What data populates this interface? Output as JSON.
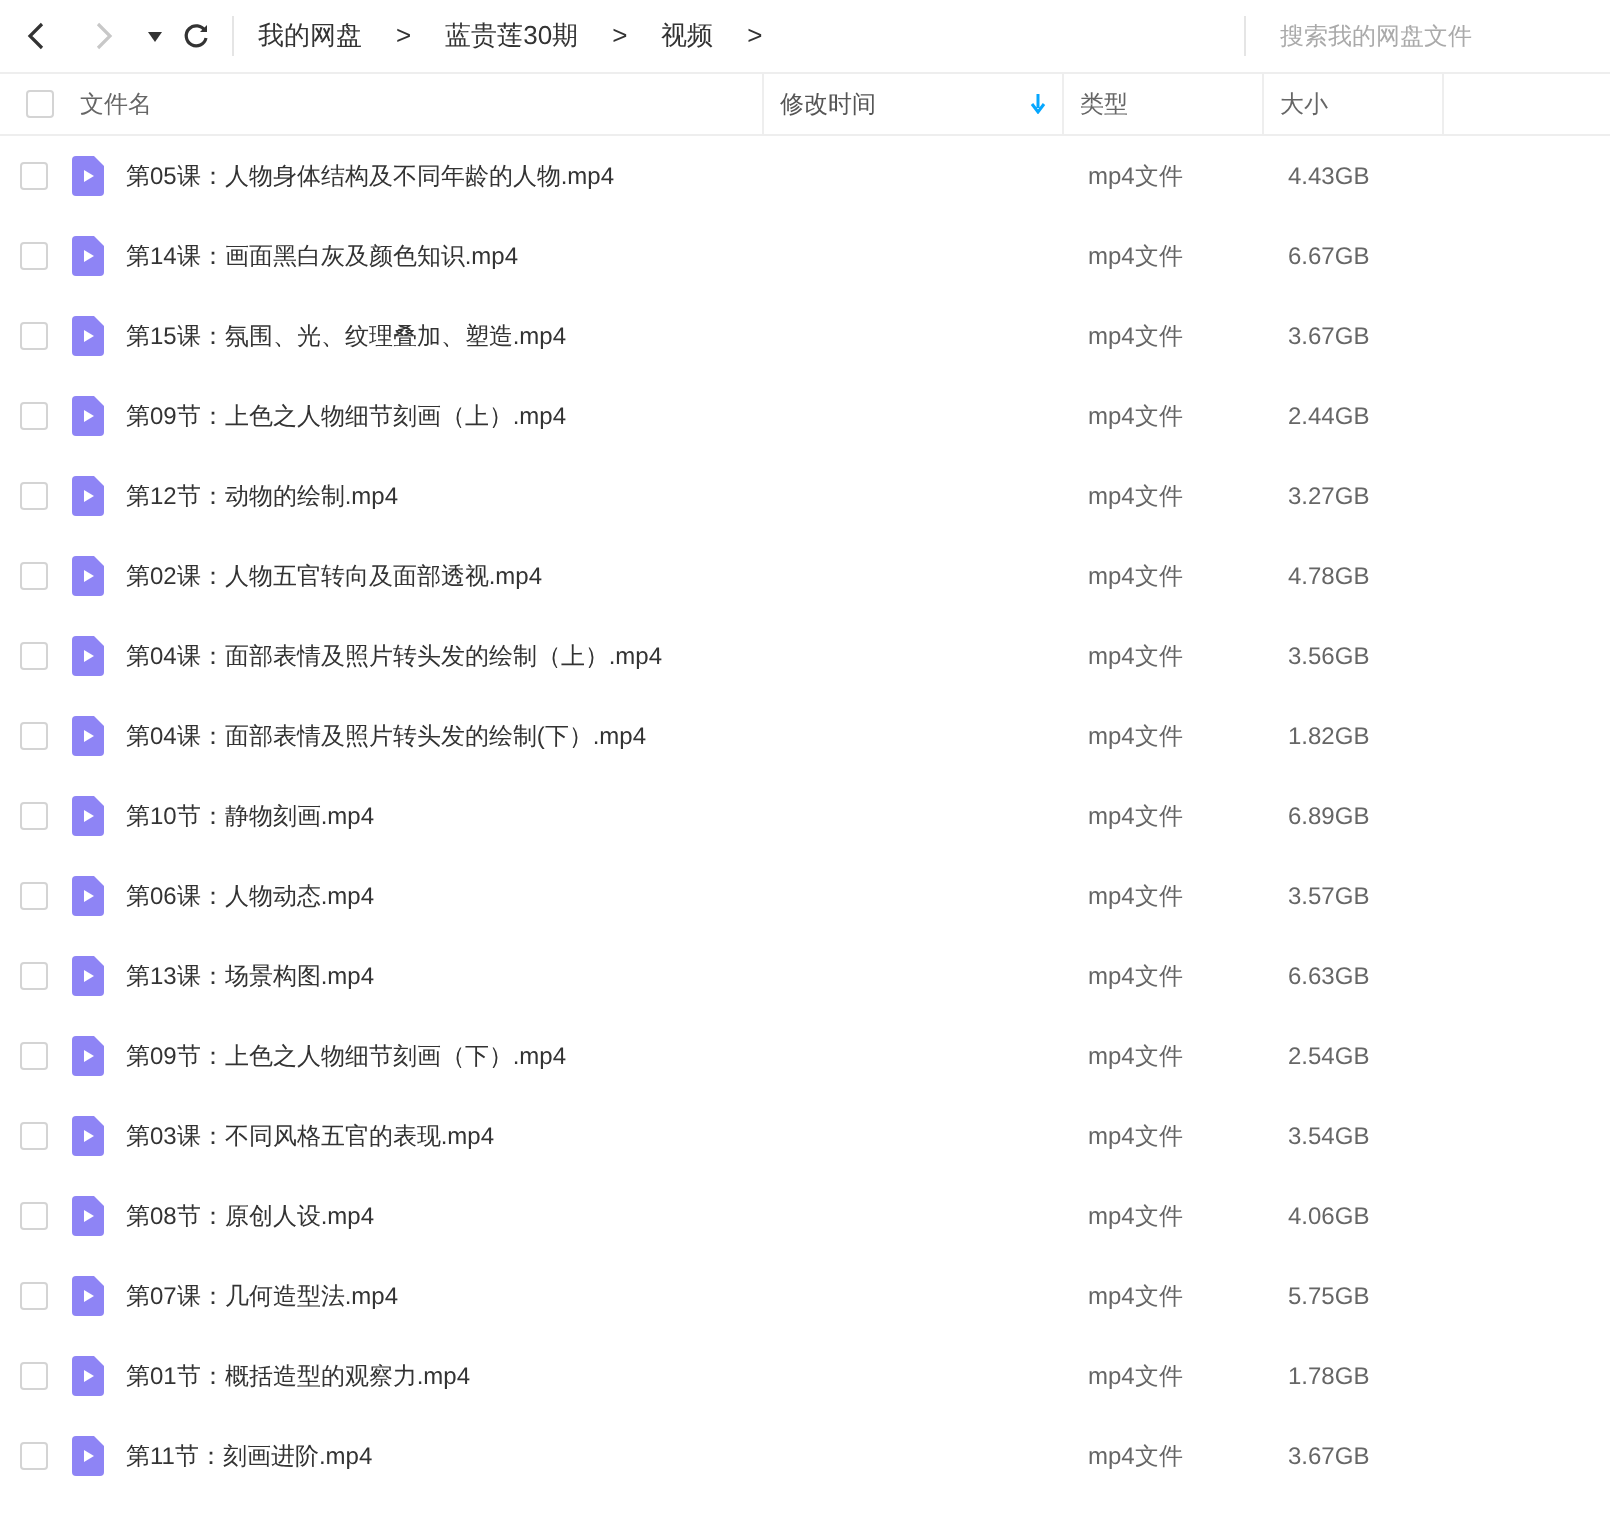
{
  "toolbar": {
    "back": {
      "disabled": false
    },
    "forward": {
      "disabled": true
    },
    "breadcrumbs": [
      {
        "label": "我的网盘",
        "separator": ">"
      },
      {
        "label": "蓝贵莲30期",
        "separator": ">"
      },
      {
        "label": "视频",
        "separator": ">"
      }
    ],
    "search": {
      "placeholder": "搜索我的网盘文件"
    }
  },
  "table": {
    "select_all": {
      "checked": false
    },
    "columns": [
      {
        "label": "文件名",
        "sorted": false
      },
      {
        "label": "修改时间",
        "sorted": true
      },
      {
        "label": "类型",
        "sorted": false
      },
      {
        "label": "大小",
        "sorted": false
      }
    ],
    "rows": [
      {
        "name": "第05课：人物身体结构及不同年龄的人物.mp4",
        "type": "mp4文件",
        "size": "4.43GB",
        "checked": false
      },
      {
        "name": "第14课：画面黑白灰及颜色知识.mp4",
        "type": "mp4文件",
        "size": "6.67GB",
        "checked": false
      },
      {
        "name": "第15课：氛围、光、纹理叠加、塑造.mp4",
        "type": "mp4文件",
        "size": "3.67GB",
        "checked": false
      },
      {
        "name": "第09节：上色之人物细节刻画（上）.mp4",
        "type": "mp4文件",
        "size": "2.44GB",
        "checked": false
      },
      {
        "name": "第12节：动物的绘制.mp4",
        "type": "mp4文件",
        "size": "3.27GB",
        "checked": false
      },
      {
        "name": "第02课：人物五官转向及面部透视.mp4",
        "type": "mp4文件",
        "size": "4.78GB",
        "checked": false
      },
      {
        "name": "第04课：面部表情及照片转头发的绘制（上）.mp4",
        "type": "mp4文件",
        "size": "3.56GB",
        "checked": false
      },
      {
        "name": "第04课：面部表情及照片转头发的绘制(下）.mp4",
        "type": "mp4文件",
        "size": "1.82GB",
        "checked": false
      },
      {
        "name": "第10节：静物刻画.mp4",
        "type": "mp4文件",
        "size": "6.89GB",
        "checked": false
      },
      {
        "name": "第06课：人物动态.mp4",
        "type": "mp4文件",
        "size": "3.57GB",
        "checked": false
      },
      {
        "name": "第13课：场景构图.mp4",
        "type": "mp4文件",
        "size": "6.63GB",
        "checked": false
      },
      {
        "name": "第09节：上色之人物细节刻画（下）.mp4",
        "type": "mp4文件",
        "size": "2.54GB",
        "checked": false
      },
      {
        "name": "第03课：不同风格五官的表现.mp4",
        "type": "mp4文件",
        "size": "3.54GB",
        "checked": false
      },
      {
        "name": "第08节：原创人设.mp4",
        "type": "mp4文件",
        "size": "4.06GB",
        "checked": false
      },
      {
        "name": "第07课：几何造型法.mp4",
        "type": "mp4文件",
        "size": "5.75GB",
        "checked": false
      },
      {
        "name": "第01节：概括造型的观察力.mp4",
        "type": "mp4文件",
        "size": "1.78GB",
        "checked": false
      },
      {
        "name": "第11节：刻画进阶.mp4",
        "type": "mp4文件",
        "size": "3.67GB",
        "checked": false
      }
    ]
  }
}
